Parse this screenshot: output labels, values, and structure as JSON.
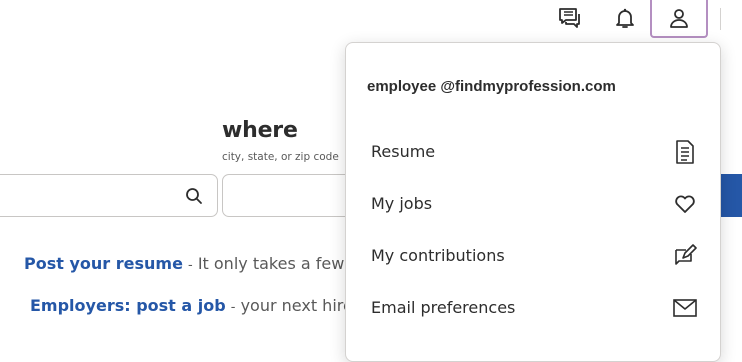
{
  "header": {
    "messages_icon": "messages-icon",
    "notifications_icon": "bell-icon",
    "profile_icon": "user-icon",
    "profile_border_color": "#b48fc1"
  },
  "search": {
    "where_title": "where",
    "where_hint": "city, state, or zip code",
    "what_value": "",
    "where_value": ""
  },
  "promos": {
    "resume_link": "Post your resume",
    "resume_text": "It only takes a few seco",
    "employers_link": "Employers: post a job",
    "employers_text": "your next hire is h",
    "separator": "-"
  },
  "account_menu": {
    "email": "employee @findmyprofession.com",
    "items": [
      {
        "label": "Resume",
        "icon": "document-icon"
      },
      {
        "label": "My jobs",
        "icon": "heart-icon"
      },
      {
        "label": "My contributions",
        "icon": "edit-icon"
      },
      {
        "label": "Email preferences",
        "icon": "envelope-icon"
      }
    ]
  },
  "colors": {
    "link": "#2557a7",
    "text": "#2d2d2d",
    "muted": "#595959"
  }
}
